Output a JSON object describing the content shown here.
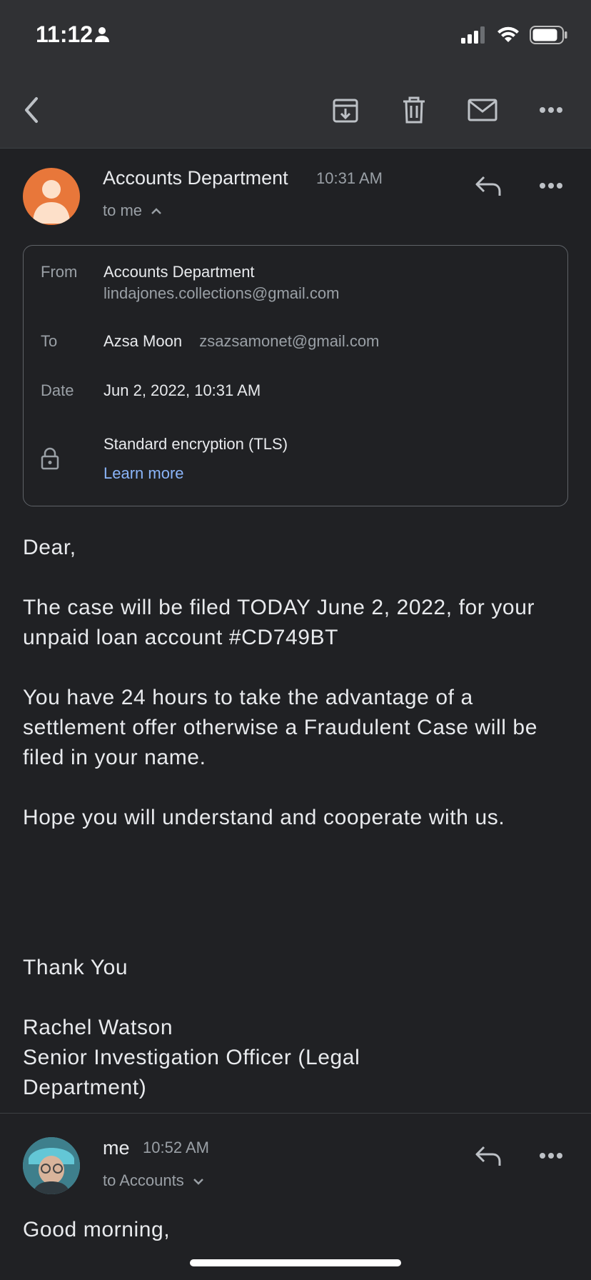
{
  "status_bar": {
    "time": "11:12"
  },
  "toolbar": {
    "ghost_text": "(obscured preview text behind toolbar)"
  },
  "message1": {
    "sender": "Accounts Department",
    "time": "10:31 AM",
    "to_line": "to me",
    "avatar_color": "#e8773a",
    "details": {
      "from_label": "From",
      "from_name": "Accounts Department",
      "from_email": "lindajones.collections@gmail.com",
      "to_label": "To",
      "to_name": "Azsa Moon",
      "to_email": "zsazsamonet@gmail.com",
      "date_label": "Date",
      "date_value": "Jun 2, 2022, 10:31 AM",
      "encryption": "Standard encryption (TLS)",
      "learn_more": "Learn more"
    },
    "body": {
      "greeting": "Dear,",
      "p1": "The case will be filed TODAY June 2, 2022, for your unpaid loan account #CD749BT",
      "p2": "You have 24 hours to take the advantage of a settlement offer otherwise a Fraudulent Case will be filed in your name.",
      "p3": "Hope you will understand and cooperate with us.",
      "closing": "Thank You",
      "sig_name": "Rachel Watson",
      "sig_title": "Senior Investigation Officer (Legal Department)"
    }
  },
  "message2": {
    "sender": "me",
    "time": "10:52 AM",
    "to_line": "to Accounts",
    "body_start": "Good morning,"
  },
  "colors": {
    "background": "#202124",
    "bar": "#303134",
    "link": "#8ab4f8",
    "muted": "#9aa0a6"
  }
}
